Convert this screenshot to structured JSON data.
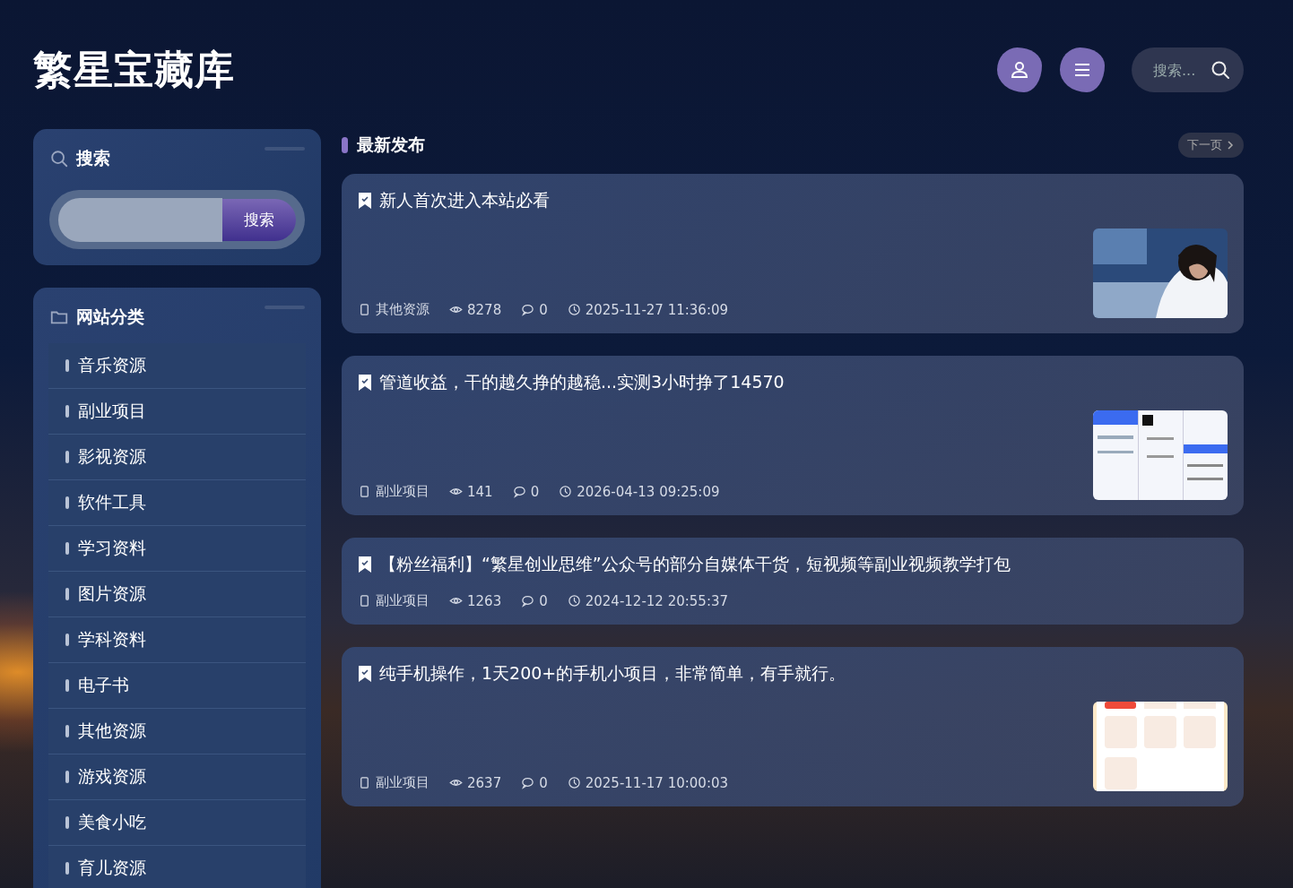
{
  "site_title": "繁星宝藏库",
  "header_search": {
    "placeholder": "搜索..."
  },
  "search_widget": {
    "title": "搜索",
    "button": "搜索"
  },
  "categories_widget": {
    "title": "网站分类",
    "items": [
      {
        "label": "音乐资源"
      },
      {
        "label": "副业项目"
      },
      {
        "label": "影视资源"
      },
      {
        "label": "软件工具"
      },
      {
        "label": "学习资料"
      },
      {
        "label": "图片资源"
      },
      {
        "label": "学科资料"
      },
      {
        "label": "电子书"
      },
      {
        "label": "其他资源"
      },
      {
        "label": "游戏资源"
      },
      {
        "label": "美食小吃"
      },
      {
        "label": "育儿资源"
      }
    ]
  },
  "section": {
    "title": "最新发布",
    "next": "下一页"
  },
  "posts": [
    {
      "title": "新人首次进入本站必看",
      "category": "其他资源",
      "views": "8278",
      "comments": "0",
      "date": "2025-11-27 11:36:09"
    },
    {
      "title": "管道收益，干的越久挣的越稳...实测3小时挣了14570",
      "category": "副业项目",
      "views": "141",
      "comments": "0",
      "date": "2026-04-13 09:25:09"
    },
    {
      "title": "【粉丝福利】“繁星创业思维”公众号的部分自媒体干货，短视频等副业视频教学打包",
      "category": "副业项目",
      "views": "1263",
      "comments": "0",
      "date": "2024-12-12 20:55:37"
    },
    {
      "title": "纯手机操作，1天200+的手机小项目，非常简单，有手就行。",
      "category": "副业项目",
      "views": "2637",
      "comments": "0",
      "date": "2025-11-17 10:00:03"
    }
  ]
}
